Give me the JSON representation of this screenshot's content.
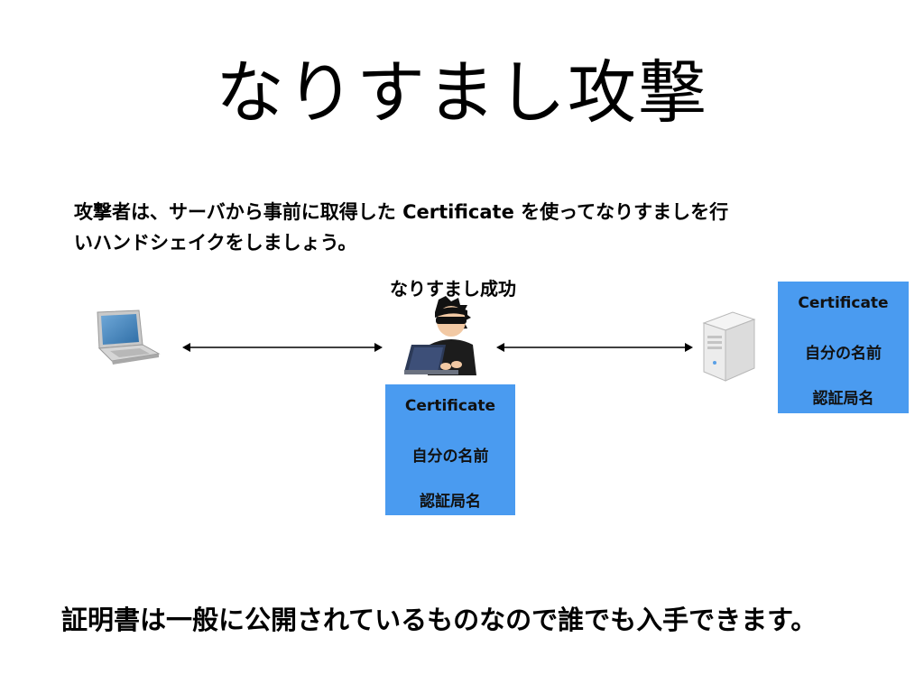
{
  "title": "なりすまし攻撃",
  "description": {
    "line1": "攻撃者は、サーバから事前に取得した Certificate を使ってなりすましを行",
    "line2": "いハンドシェイクをしましょう。"
  },
  "attacker_label": "なりすまし成功",
  "attacker_certificate": {
    "title": "Certificate",
    "name": "自分の名前",
    "ca": "認証局名"
  },
  "server_certificate": {
    "title": "Certificate",
    "name": "自分の名前",
    "ca": "認証局名"
  },
  "footer": "証明書は一般に公開されているものなので誰でも入手できます。",
  "icons": {
    "client": "laptop-icon",
    "attacker": "hacker-icon",
    "server": "server-icon"
  },
  "colors": {
    "certificate_bg": "#4a9bf0"
  }
}
